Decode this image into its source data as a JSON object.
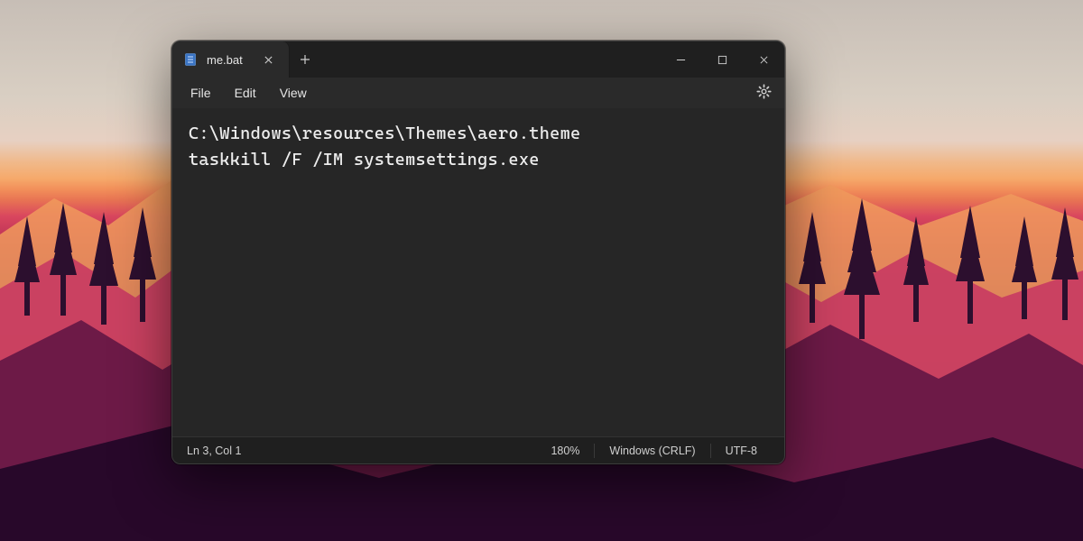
{
  "tab": {
    "title": "me.bat",
    "icon": "notepad-file-icon"
  },
  "menu": {
    "file": "File",
    "edit": "Edit",
    "view": "View"
  },
  "editor": {
    "content": "C:\\Windows\\resources\\Themes\\aero.theme\ntaskkill /F /IM systemsettings.exe"
  },
  "status": {
    "cursor": "Ln 3, Col 1",
    "zoom": "180%",
    "line_endings": "Windows (CRLF)",
    "encoding": "UTF-8"
  },
  "colors": {
    "window_bg": "#2a2a2a",
    "titlebar_bg": "#1f1f1f",
    "editor_bg": "#262626",
    "text": "#ededed"
  }
}
